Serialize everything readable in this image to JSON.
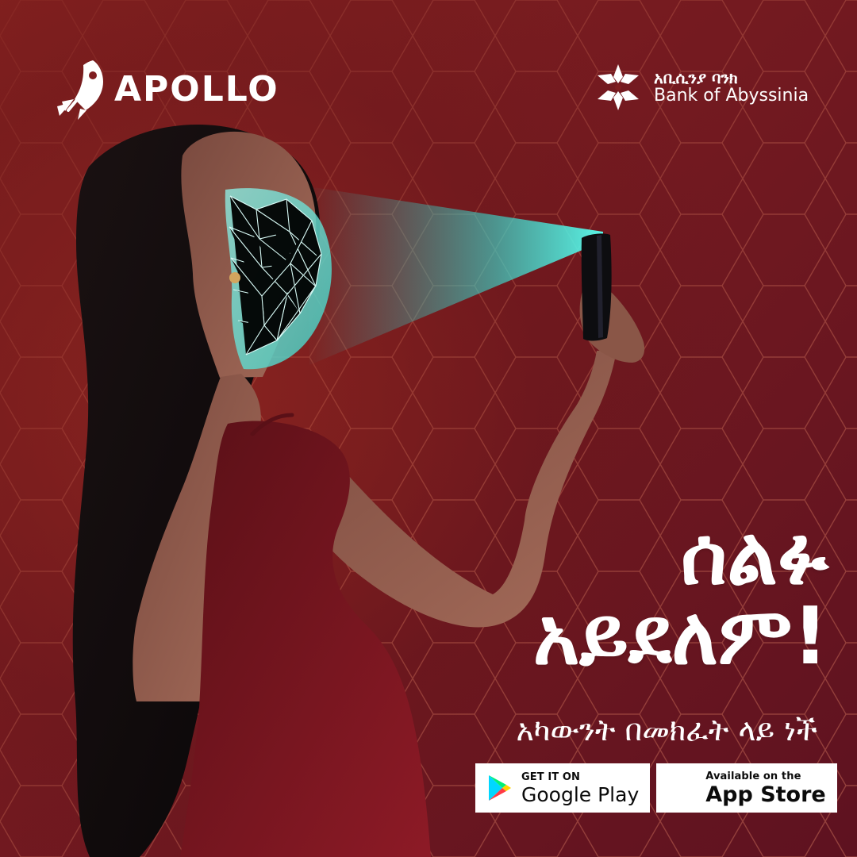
{
  "brand": {
    "apollo": {
      "name": "APOLLO",
      "icon": "rocket-icon"
    },
    "bank": {
      "amharic_name": "አቢሲንያ ባንክ",
      "english_name": "Bank of Abyssinia",
      "icon": "star-mark-icon"
    }
  },
  "hero": {
    "headline_line_1": "ሰልፉ",
    "headline_line_2": "አይደለም!",
    "subheadline": "አካውንት በመክፈት ላይ ነች"
  },
  "stores": {
    "google_play": {
      "overline": "GET IT ON",
      "name": "Google Play",
      "icon": "google-play-icon"
    },
    "app_store": {
      "overline": "Available on the",
      "name": "App Store",
      "icon": "apple-icon",
      "icon_glyph": ""
    }
  },
  "colors": {
    "background_primary": "#7f1d20",
    "background_secondary": "#5e1220",
    "accent_teal": "#3fe2d2",
    "text_light": "#ffffff"
  }
}
